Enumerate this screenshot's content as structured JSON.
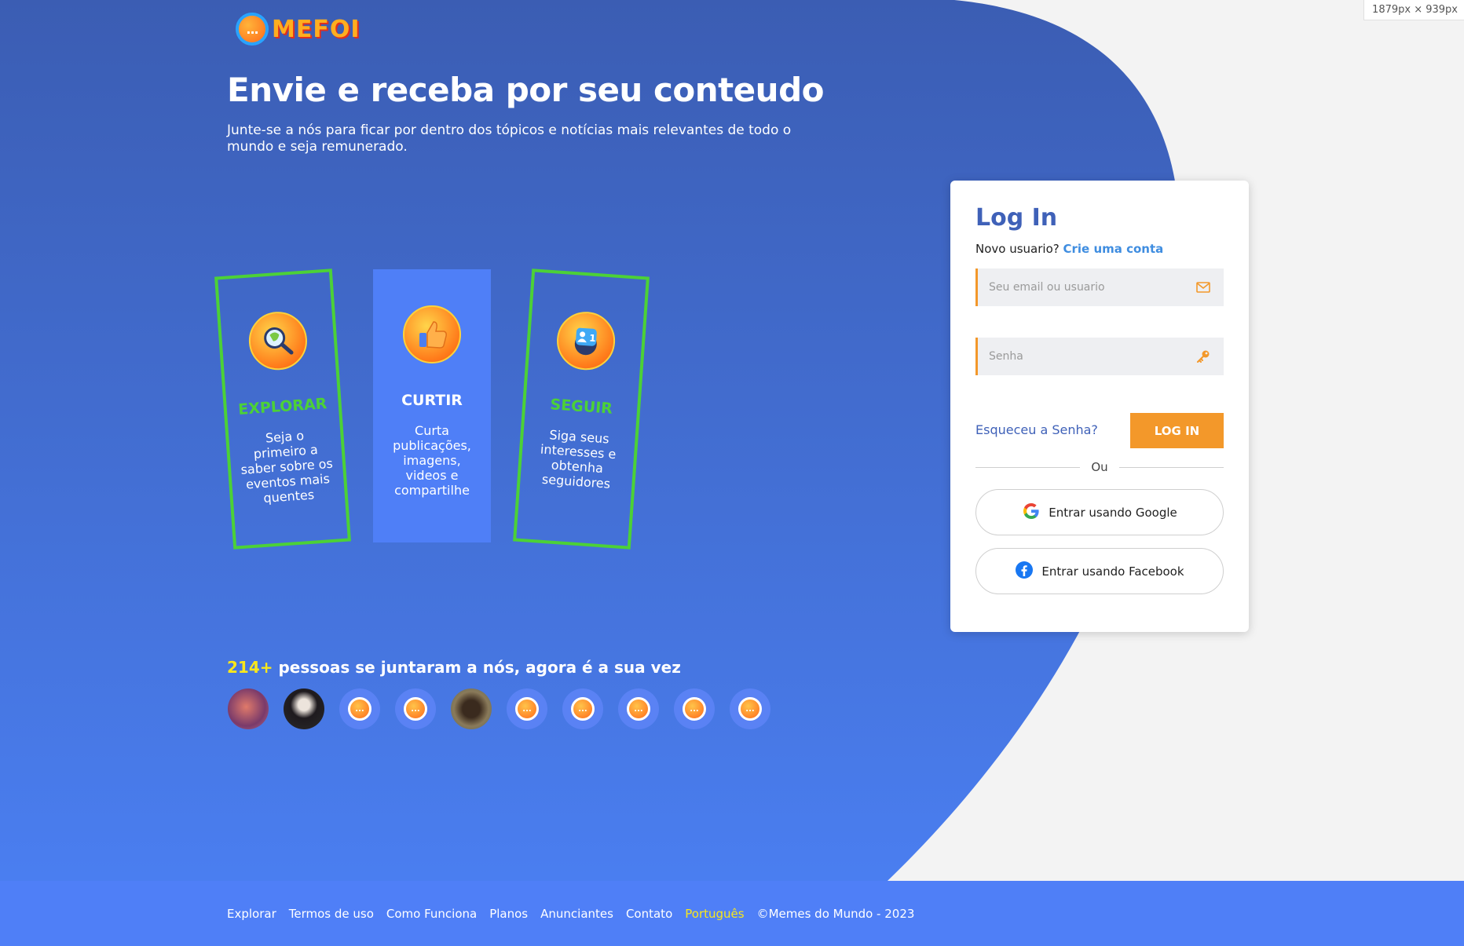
{
  "screen_badge": "1879px × 939px",
  "brand": {
    "logo_text": "MEFOI",
    "logo_glyph": "..."
  },
  "hero": {
    "title": "Envie e receba por seu conteudo",
    "subtitle": "Junte-se a nós para ficar por dentro dos tópicos e notícias mais relevantes de todo o mundo e seja remunerado."
  },
  "features": [
    {
      "title": "EXPLORAR",
      "text": "Seja o primeiro a saber sobre os eventos mais quentes",
      "icon": "magnifier-globe-icon"
    },
    {
      "title": "CURTIR",
      "text": "Curta publicações, imagens, videos e compartilhe",
      "icon": "thumbs-up-icon"
    },
    {
      "title": "SEGUIR",
      "text": "Siga seus interesses e obtenha seguidores",
      "icon": "followers-icon"
    }
  ],
  "community": {
    "count": "214+",
    "text": " pessoas se juntaram a nós, agora é a sua vez",
    "avatars": [
      "photo",
      "photo",
      "default",
      "default",
      "photo",
      "default",
      "default",
      "default",
      "default",
      "default"
    ]
  },
  "login": {
    "title": "Log In",
    "new_user_prompt": "Novo usuario?",
    "create_account_link": "Crie uma conta",
    "email_placeholder": "Seu email ou usuario",
    "password_placeholder": "Senha",
    "forgot_link": "Esqueceu a Senha?",
    "submit_label": "LOG IN",
    "divider": "Ou",
    "google_label": "Entrar usando Google",
    "facebook_label": "Entrar usando Facebook"
  },
  "footer": {
    "links": [
      "Explorar",
      "Termos de uso",
      "Como Funciona",
      "Planos",
      "Anunciantes",
      "Contato"
    ],
    "language": "Português",
    "copyright": "©Memes do Mundo - 2023"
  },
  "colors": {
    "hero_top": "#3b5db3",
    "hero_bottom": "#4a7ef0",
    "accent_orange": "#f3982a",
    "accent_green": "#4cd137",
    "highlight_yellow": "#f8e71c",
    "footer_bg": "#4f7ff7"
  }
}
